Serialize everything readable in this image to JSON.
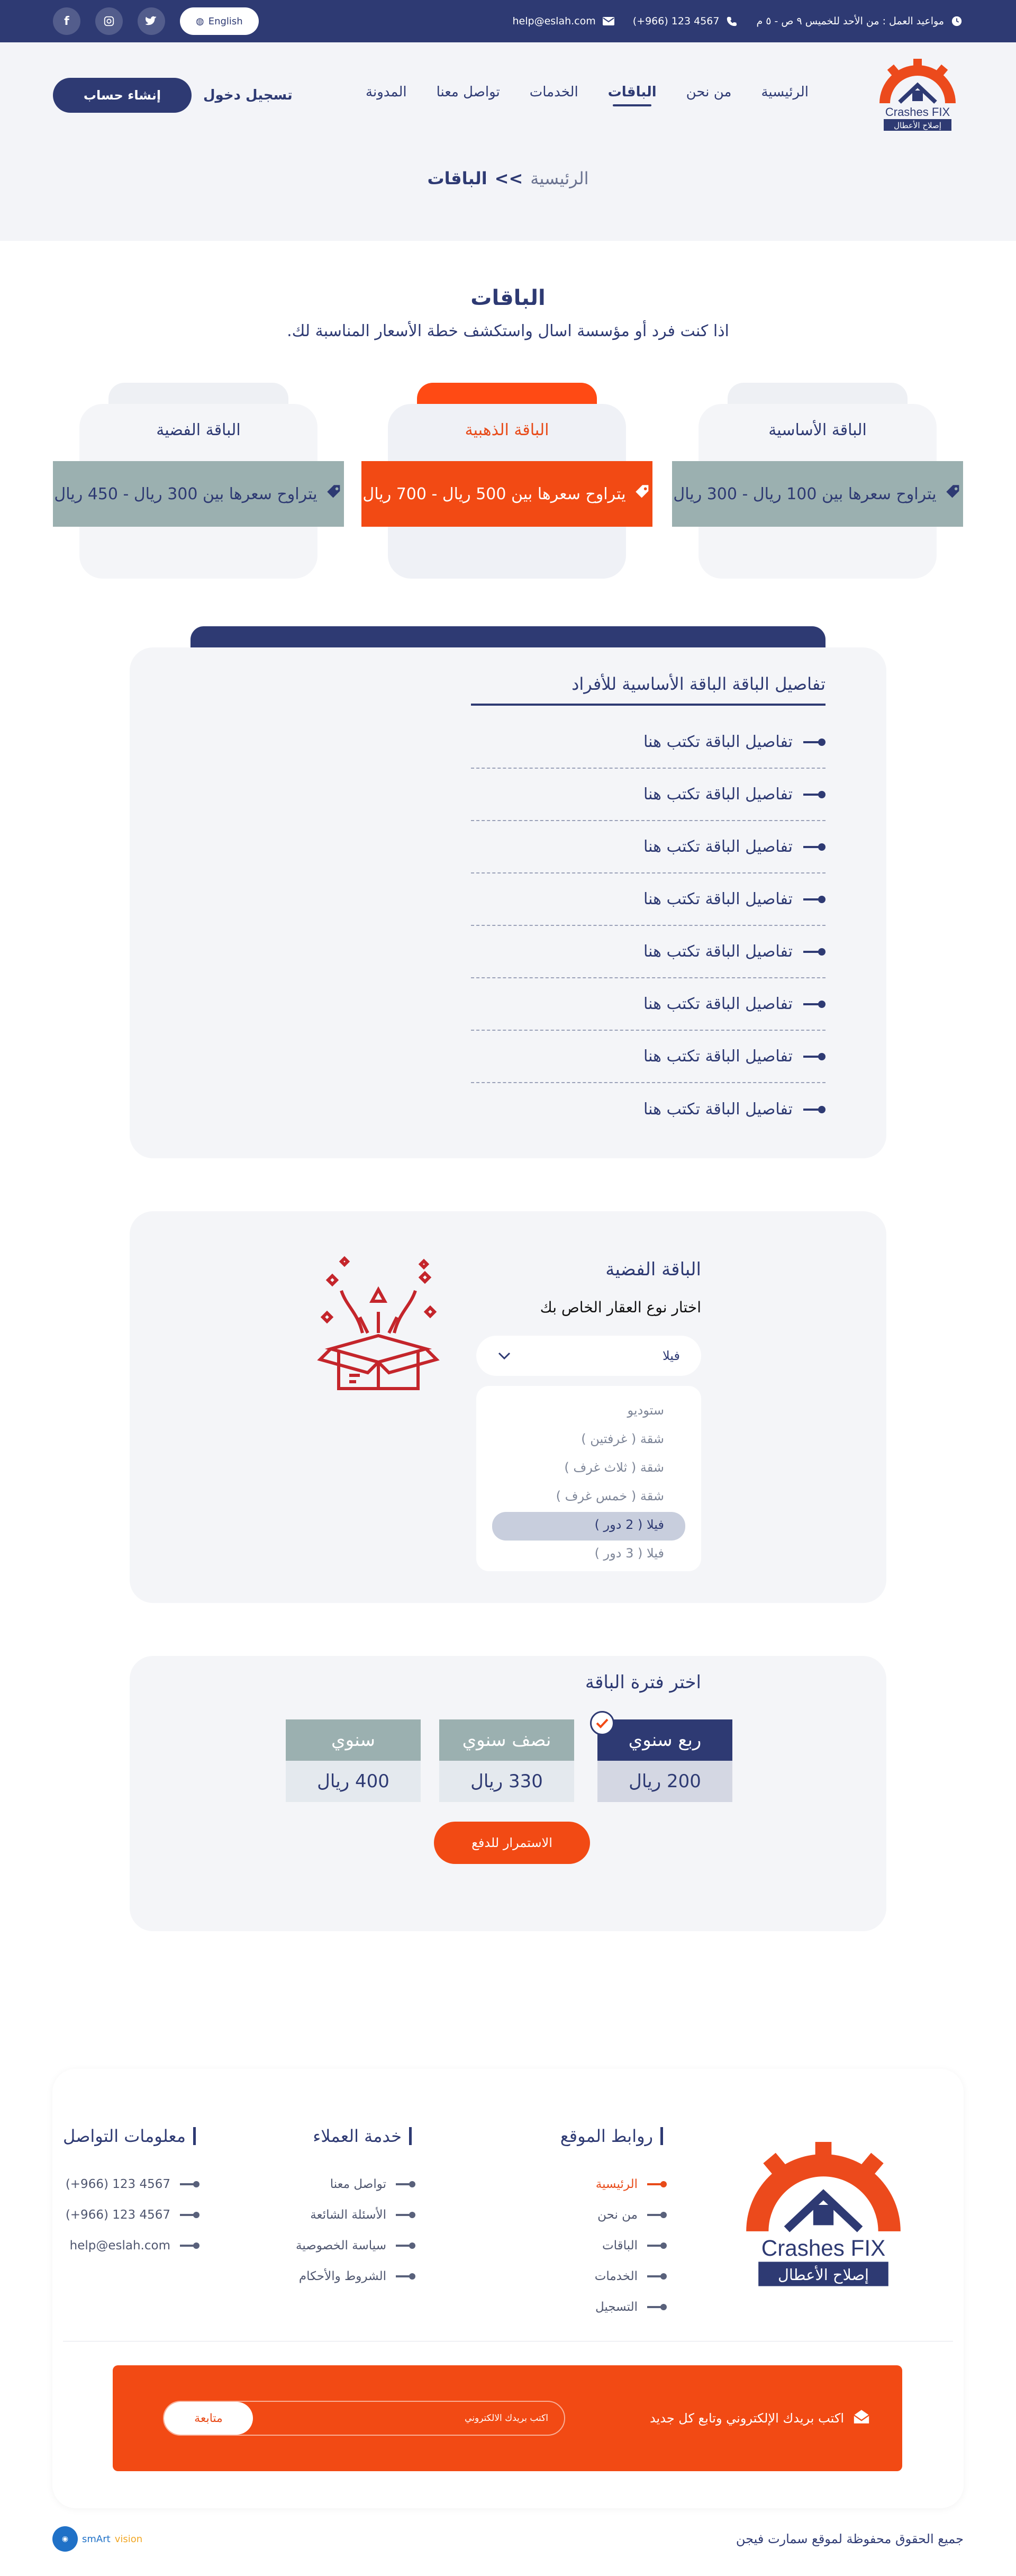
{
  "topbar": {
    "hours": "مواعيد العمل : من الأحد للخميس ٩ ص - ٥ م",
    "phone": "(+966) 123 4567",
    "email": "help@eslah.com",
    "language": "English",
    "social": [
      "twitter",
      "instagram",
      "facebook"
    ]
  },
  "logo": {
    "title": "Crashes FIX",
    "subtitle": "إصلاح الأعطال"
  },
  "nav": {
    "items": [
      "الرئيسية",
      "من نحن",
      "الباقات",
      "الخدمات",
      "تواصل معنا",
      "المدونة"
    ],
    "active": "الباقات",
    "login": "تسجيل دخول",
    "signup": "إنشاء حساب"
  },
  "breadcrumb": {
    "home": "الرئيسية",
    "sep": ">>",
    "current": "الباقات"
  },
  "packages": {
    "title": "الباقات",
    "subtitle": "اذا كنت فرد أو مؤسسة اسال واستكشف خطة الأسعار المناسبة لك.",
    "cards": [
      {
        "name": "الباقة الأساسية",
        "price": "يتراوح سعرها بين 100 ريال - 300 ريال"
      },
      {
        "name": "الباقة الذهبية",
        "price": "يتراوح سعرها بين 500 ريال - 700 ريال"
      },
      {
        "name": "الباقة الفضية",
        "price": "يتراوح سعرها بين 300 ريال - 450 ريال"
      }
    ]
  },
  "details": {
    "title": "تفاصيل الباقة الباقة الأساسية للأفراد",
    "items": [
      "تفاصيل الباقة تكتب هنا",
      "تفاصيل الباقة تكتب هنا",
      "تفاصيل الباقة تكتب هنا",
      "تفاصيل الباقة تكتب هنا",
      "تفاصيل الباقة تكتب هنا",
      "تفاصيل الباقة تكتب هنا",
      "تفاصيل الباقة تكتب هنا",
      "تفاصيل الباقة تكتب هنا"
    ]
  },
  "silver": {
    "title": "الباقة الفضية",
    "question": "اختار نوع العقار الخاص بك",
    "selected": "فيلا",
    "options": [
      "ستوديو",
      "شقة ( غرفتين )",
      "شقة ( ثلاث غرف )",
      "شقة ( خمس غرف )",
      "فيلا ( 2 دور )",
      "فيلا ( 3 دور )"
    ],
    "highlighted": "فيلا ( 2 دور )"
  },
  "period": {
    "title": "اختر فترة الباقة",
    "plans": [
      {
        "label": "ربع سنوي",
        "price": "200 ريال",
        "selected": true
      },
      {
        "label": "نصف سنوي",
        "price": "330 ريال",
        "selected": false
      },
      {
        "label": "سنوي",
        "price": "400 ريال",
        "selected": false
      }
    ],
    "continue": "الاستمرار للدفع"
  },
  "footer": {
    "links_title": "روابط الموقع",
    "links": [
      "الرئيسية",
      "من نحن",
      "الباقات",
      "الخدمات",
      "التسجيل"
    ],
    "service_title": "خدمة العملاء",
    "service": [
      "تواصل معنا",
      "الأسئلة الشائعة",
      "سياسة الخصوصية",
      "الشروط والأحكام"
    ],
    "contact_title": "معلومات التواصل",
    "contact": [
      "(+966) 123 4567",
      "(+966) 123 4567",
      "help@eslah.com"
    ],
    "newsletter_text": "اكتب بريدك الإلكتروني وتابع كل جديد",
    "newsletter_placeholder": "اكتب بريدك الالكتروني",
    "newsletter_button": "متابعة",
    "copyright": "جميع الحقوق محفوظة لموقع سمارت فيجن",
    "credit_1": "smArt",
    "credit_2": "vision"
  },
  "colors": {
    "navy": "#2e3a73",
    "orange": "#f24a14",
    "silver": "#9bb0b0",
    "panel": "#f4f5f8"
  }
}
